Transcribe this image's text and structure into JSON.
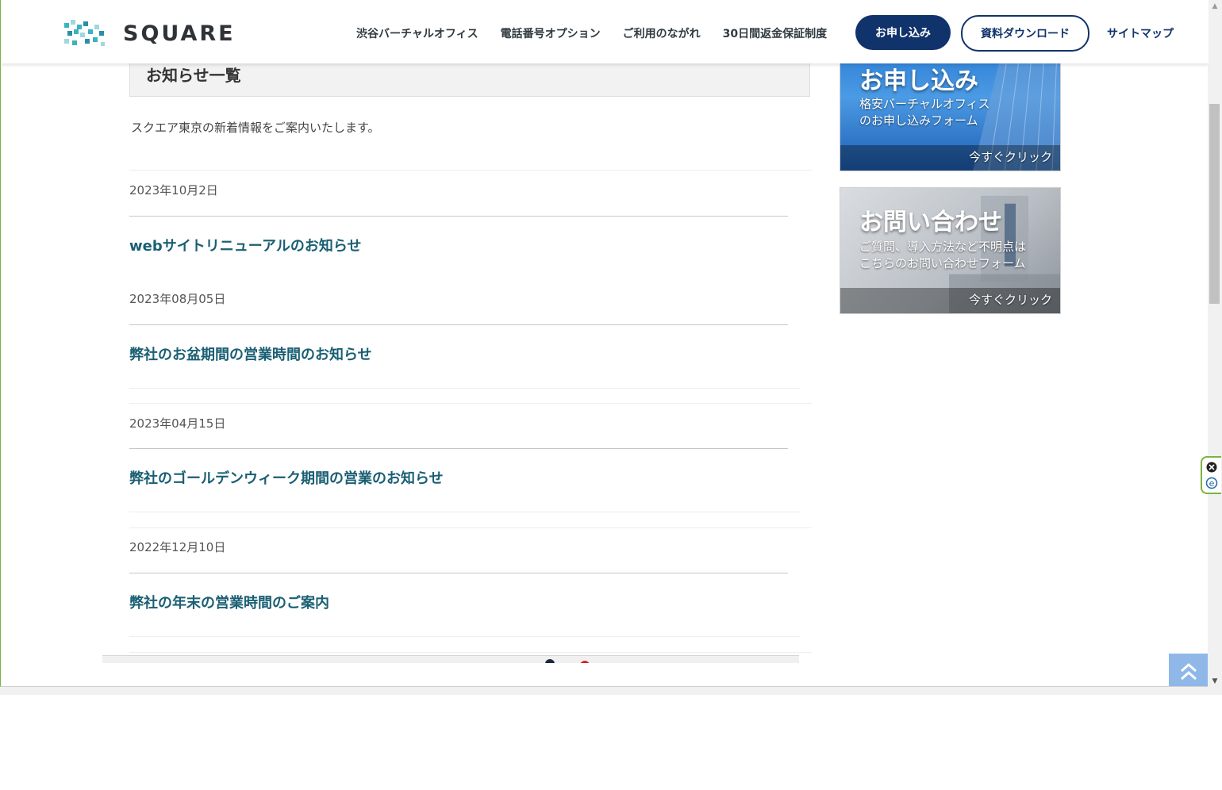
{
  "header": {
    "logo_text": "SQUARE",
    "nav": [
      {
        "label": "渋谷バーチャルオフィス"
      },
      {
        "label": "電話番号オプション"
      },
      {
        "label": "ご利用のながれ"
      },
      {
        "label": "30日間返金保証制度"
      }
    ],
    "apply_button": "お申し込み",
    "download_button": "資料ダウンロード",
    "sitemap_link": "サイトマップ"
  },
  "main": {
    "section_title": "お知らせ一覧",
    "intro": "スクエア東京の新着情報をご案内いたします。",
    "news": [
      {
        "date": "2023年10月2日",
        "title": "webサイトリニューアルのお知らせ"
      },
      {
        "date": "2023年08月05日",
        "title": "弊社のお盆期間の営業時間のお知らせ"
      },
      {
        "date": "2023年04月15日",
        "title": "弊社のゴールデンウィーク期間の営業のお知らせ"
      },
      {
        "date": "2022年12月10日",
        "title": "弊社の年末の営業時間のご案内"
      }
    ]
  },
  "sidebar": {
    "apply_banner": {
      "heading": "お申し込み",
      "line1": "格安バーチャルオフィス",
      "line2": "のお申し込みフォーム",
      "cta": "今すぐクリック"
    },
    "contact_banner": {
      "heading": "お問い合わせ",
      "line1": "ご質問、導入方法など不明点は",
      "line2": "こちらのお問い合わせフォーム",
      "cta": "今すぐクリック"
    }
  },
  "colors": {
    "brand_navy": "#11336b",
    "link_teal": "#1a5f73",
    "extension_green": "#7cb342"
  },
  "icons": {
    "logo": "square-logo-icon",
    "back_to_top": "double-chevron-up-icon",
    "widget_close": "close-circle-icon",
    "widget_ext": "extension-e-icon"
  }
}
